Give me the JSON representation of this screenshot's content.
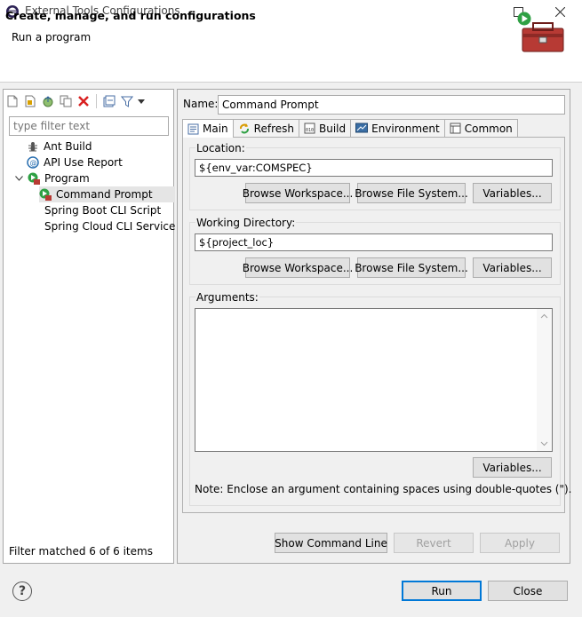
{
  "window": {
    "title": "External Tools Configurations"
  },
  "header": {
    "title": "Create, manage, and run configurations",
    "subtitle": "Run a program"
  },
  "left": {
    "filter_placeholder": "type filter text",
    "tree": [
      {
        "label": "Ant Build"
      },
      {
        "label": "API Use Report"
      },
      {
        "label": "Program"
      },
      {
        "label": "Command Prompt"
      },
      {
        "label": "Spring Boot CLI Script"
      },
      {
        "label": "Spring Cloud CLI Service"
      }
    ],
    "status": "Filter matched 6 of 6 items"
  },
  "config": {
    "name_label": "Name:",
    "name_value": "Command Prompt",
    "tabs": [
      "Main",
      "Refresh",
      "Build",
      "Environment",
      "Common"
    ],
    "location_label": "Location:",
    "location_value": "${env_var:COMSPEC}",
    "workdir_label": "Working Directory:",
    "workdir_value": "${project_loc}",
    "arguments_label": "Arguments:",
    "browse_workspace": "Browse Workspace...",
    "browse_filesystem": "Browse File System...",
    "variables": "Variables...",
    "note": "Note: Enclose an argument containing spaces using double-quotes (\")."
  },
  "actions": {
    "show_command_line": "Show Command Line",
    "revert": "Revert",
    "apply": "Apply",
    "run": "Run",
    "close": "Close"
  },
  "help_glyph": "?"
}
